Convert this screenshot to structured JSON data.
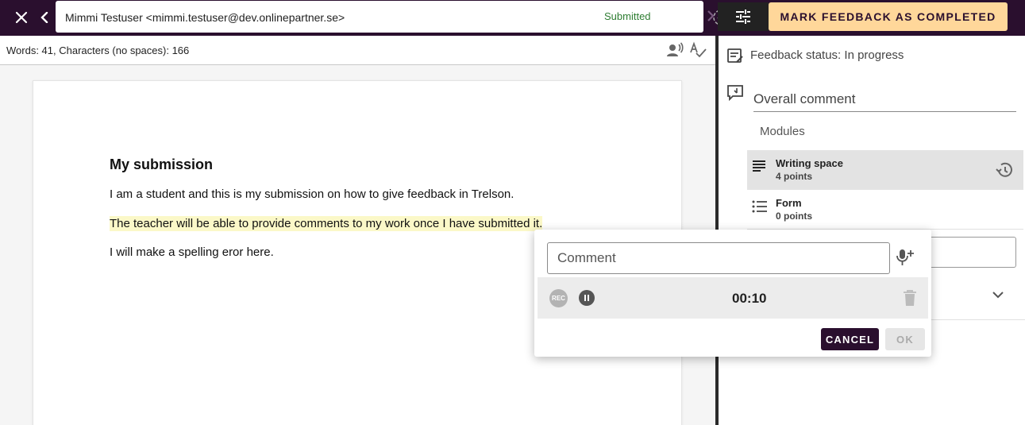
{
  "header": {
    "student_name": "Mimmi Testuser <mimmi.testuser@dev.onlinepartner.se>",
    "status": "Submitted",
    "complete_button": "MARK FEEDBACK AS COMPLETED"
  },
  "toolbar": {
    "wordcount": "Words: 41, Characters (no spaces): 166"
  },
  "document": {
    "title": "My submission",
    "paragraphs": [
      "I am a student and this is my submission on how to give feedback in Trelson.",
      "The teacher will be able to provide comments to my work once I have submitted it.",
      "I will make a spelling eror here."
    ]
  },
  "panel": {
    "feedback_status": "Feedback status: In progress",
    "overall_comment": "Overall comment",
    "modules_label": "Modules",
    "modules": [
      {
        "name": "Writing space",
        "points": "4 points"
      },
      {
        "name": "Form",
        "points": "0 points"
      }
    ]
  },
  "popup": {
    "comment_placeholder": "Comment",
    "rec_label": "REC",
    "timer": "00:10",
    "cancel": "CANCEL",
    "ok": "OK"
  },
  "colors": {
    "brand_dark": "#2a0f2e",
    "accent": "#ffd79a",
    "status_green": "#2e7d32",
    "highlight": "#fbf8c8"
  }
}
